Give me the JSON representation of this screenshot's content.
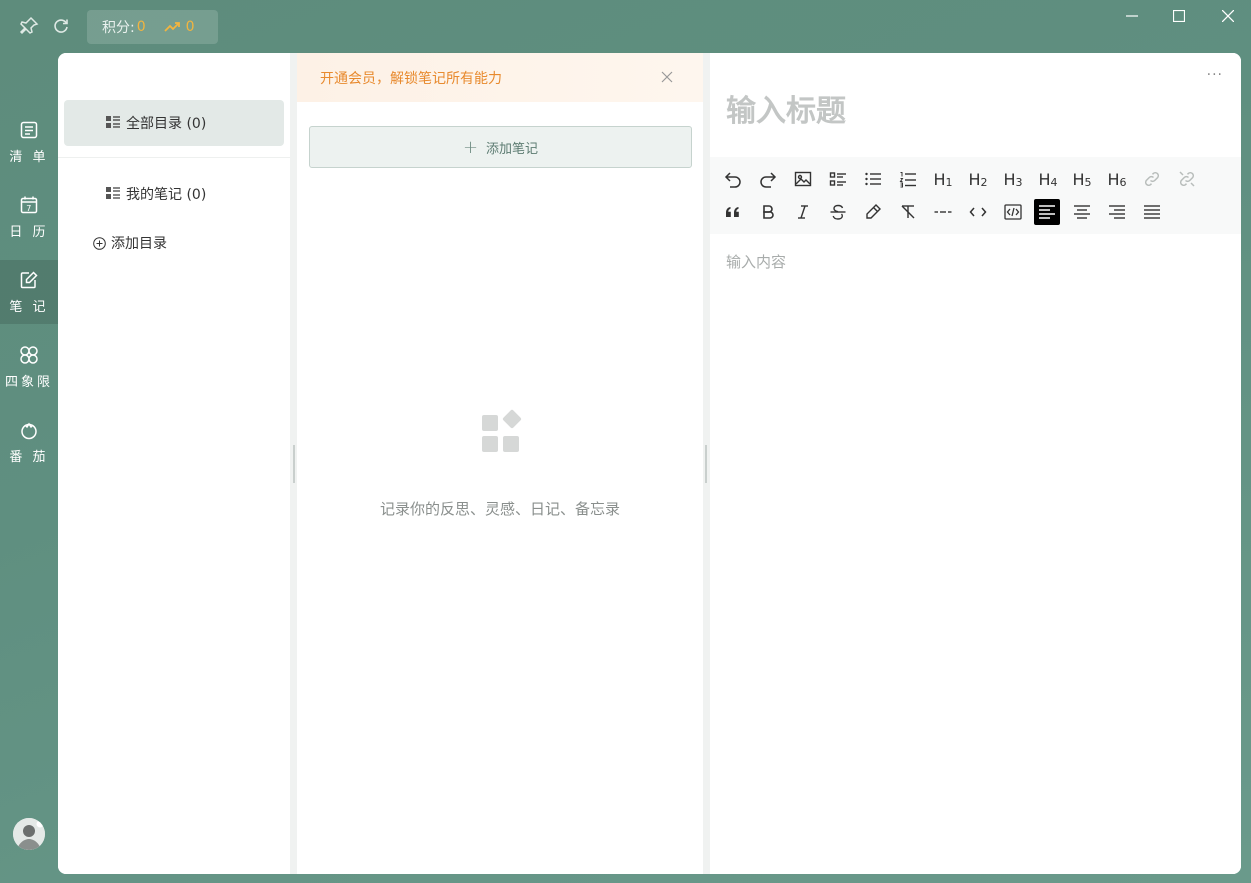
{
  "titlebar": {
    "score_label": "积分:",
    "score_value": "0",
    "trend_value": "0"
  },
  "nav": {
    "items": [
      {
        "label": "清 单",
        "icon": "list-icon"
      },
      {
        "label": "日 历",
        "icon": "calendar-icon",
        "calendar_day": "7"
      },
      {
        "label": "笔 记",
        "icon": "note-edit-icon"
      },
      {
        "label": "四象限",
        "icon": "quadrant-icon"
      },
      {
        "label": "番 茄",
        "icon": "tomato-icon"
      }
    ],
    "active_index": 2
  },
  "catalog": {
    "all": "全部目录 (0)",
    "mine": "我的笔记 (0)",
    "add": "添加目录"
  },
  "notes": {
    "banner": "开通会员，解锁笔记所有能力",
    "add_note": "添加笔记",
    "empty_text": "记录你的反思、灵感、日记、备忘录"
  },
  "editor": {
    "more": "···",
    "title_placeholder": "输入标题",
    "content_placeholder": "输入内容",
    "toolbar_row1": [
      "undo",
      "redo",
      "image",
      "task-list",
      "bullet-list",
      "ordered-list",
      "h1",
      "h2",
      "h3",
      "h4",
      "h5",
      "h6",
      "link",
      "unlink"
    ],
    "toolbar_row2": [
      "quote",
      "bold",
      "italic",
      "strikethrough",
      "highlight",
      "clear-format",
      "horizontal-rule",
      "inline-code",
      "code-block",
      "align-left",
      "align-center",
      "align-right",
      "align-justify"
    ],
    "headings": {
      "h1": "1",
      "h2": "2",
      "h3": "3",
      "h4": "4",
      "h5": "5",
      "h6": "6"
    }
  },
  "colors": {
    "accent": "#5e8c7c",
    "warning": "#e88a2e",
    "score": "#f2b53f"
  }
}
